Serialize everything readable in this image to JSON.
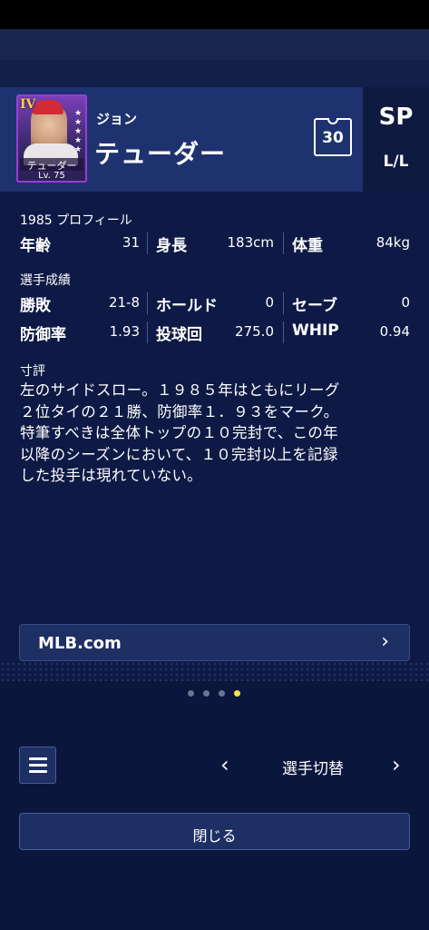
{
  "player": {
    "card_rank": "IV",
    "card_name": "テューダー",
    "card_level": "Lv. 75",
    "first_name": "ジョン",
    "last_name": "テューダー",
    "uniform_number": "30",
    "position": "SP",
    "handedness": "L/L"
  },
  "profile": {
    "title": "1985 プロフィール",
    "age_label": "年齢",
    "age_value": "31",
    "height_label": "身長",
    "height_value": "183cm",
    "weight_label": "体重",
    "weight_value": "84kg"
  },
  "stats": {
    "title": "選手成績",
    "wl_label": "勝敗",
    "wl_value": "21-8",
    "hold_label": "ホールド",
    "hold_value": "0",
    "save_label": "セーブ",
    "save_value": "0",
    "era_label": "防御率",
    "era_value": "1.93",
    "ip_label": "投球回",
    "ip_value": "275.0",
    "whip_label": "WHIP",
    "whip_value": "0.94"
  },
  "comment": {
    "title": "寸評",
    "lines": [
      "左のサイドスロー。１９８５年はともにリーグ",
      "２位タイの２１勝、防御率１．９３をマーク。",
      "特筆すべきは全体トップの１０完封で、この年",
      "以降のシーズンにおいて、１０完封以上を記録",
      "した投手は現れていない。"
    ]
  },
  "link": {
    "label": "MLB.com",
    "icon": "chevron-right-icon"
  },
  "pager": {
    "total": 4,
    "active": 4
  },
  "nav": {
    "menu_icon": "menu-icon",
    "prev": "‹",
    "label": "選手切替",
    "next": "›"
  },
  "close": {
    "label": "閉じる"
  },
  "colors": {
    "background": "#0e1a45",
    "header": "#1f3270",
    "accent_dot": "#f3e34a",
    "card_border": "#9a3dd6"
  }
}
